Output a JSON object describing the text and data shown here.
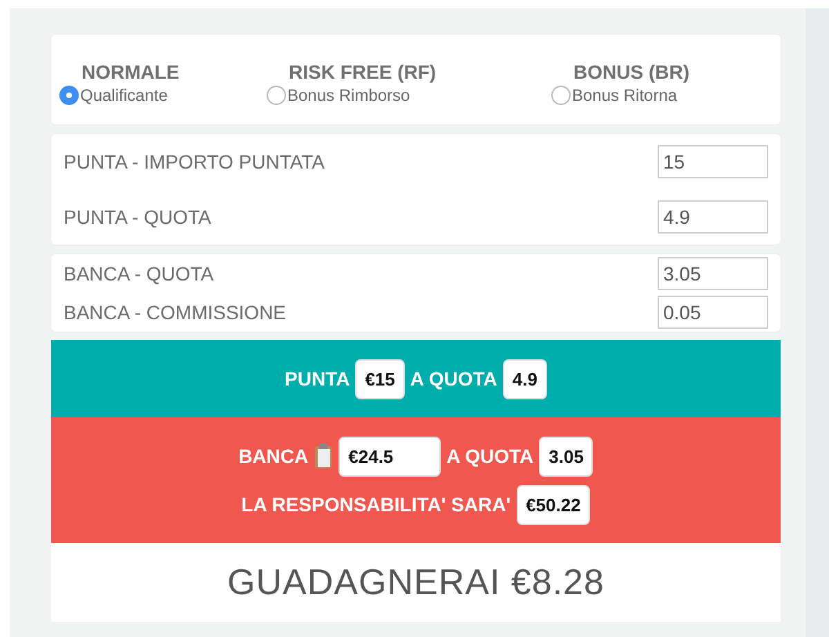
{
  "modes": [
    {
      "title": "NORMALE",
      "label": "Qualificante",
      "selected": true
    },
    {
      "title": "RISK FREE (RF)",
      "label": "Bonus Rimborso",
      "selected": false
    },
    {
      "title": "BONUS (BR)",
      "label": "Bonus Ritorna",
      "selected": false
    }
  ],
  "field_groups": [
    {
      "fields": [
        {
          "label": "PUNTA - IMPORTO PUNTATA",
          "value": "15"
        },
        {
          "label": "PUNTA - QUOTA",
          "value": "4.9"
        }
      ],
      "spacious": true
    },
    {
      "fields": [
        {
          "label": "BANCA - QUOTA",
          "value": "3.05"
        },
        {
          "label": "BANCA - COMMISSIONE",
          "value": "0.05"
        }
      ],
      "spacious": false
    }
  ],
  "punta": {
    "label": "PUNTA",
    "stake": "€15",
    "odds_label": "A QUOTA",
    "odds": "4.9"
  },
  "banca": {
    "label": "BANCA",
    "stake": "€24.5",
    "odds_label": "A QUOTA",
    "odds": "3.05",
    "liability_label": "LA RESPONSABILITA' SARA'",
    "liability": "€50.22"
  },
  "result": "GUADAGNERAI €8.28"
}
